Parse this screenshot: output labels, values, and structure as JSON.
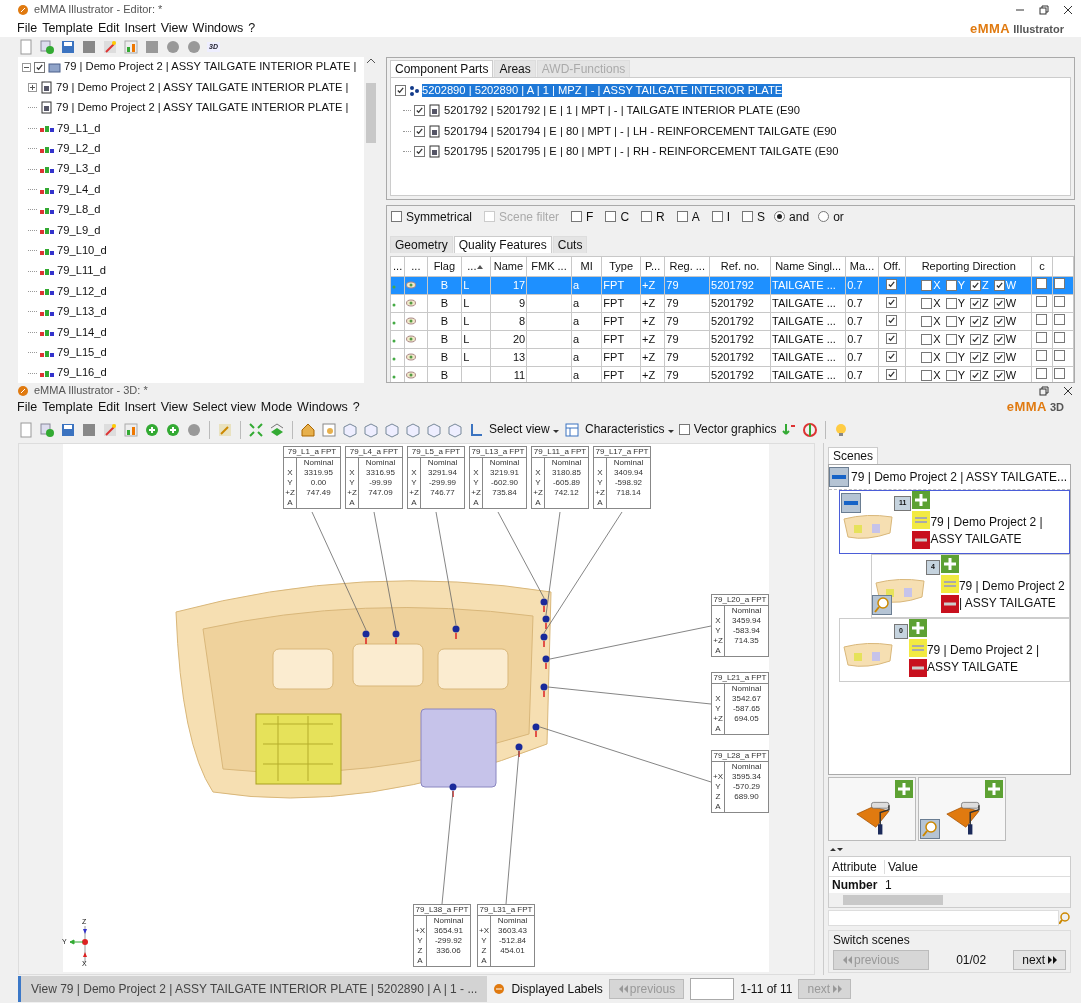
{
  "editor": {
    "title": "eMMA Illustrator - Editor: *",
    "brand_mark": "eMMA",
    "brand_name": "Illustrator",
    "menus": [
      "File",
      "Template",
      "Edit",
      "Insert",
      "View",
      "Windows",
      "?"
    ],
    "toolbar_badge": "3D",
    "tree": {
      "kind": "project",
      "label": "79 | Demo Project 2 | ASSY TAILGATE INTERIOR PLATE |",
      "checked": true,
      "expanded": true,
      "children": [
        {
          "kind": "part",
          "label": "79 | Demo Project 2 | ASSY TAILGATE INTERIOR PLATE |",
          "expanded": false
        },
        {
          "kind": "part",
          "label": "79 | Demo Project 2 | ASSY TAILGATE INTERIOR PLATE |"
        },
        {
          "kind": "feature",
          "label": "79_L1_d"
        },
        {
          "kind": "feature",
          "label": "79_L2_d"
        },
        {
          "kind": "feature",
          "label": "79_L3_d"
        },
        {
          "kind": "feature",
          "label": "79_L4_d"
        },
        {
          "kind": "feature",
          "label": "79_L8_d"
        },
        {
          "kind": "feature",
          "label": "79_L9_d"
        },
        {
          "kind": "feature",
          "label": "79_L10_d"
        },
        {
          "kind": "feature",
          "label": "79_L11_d"
        },
        {
          "kind": "feature",
          "label": "79_L12_d"
        },
        {
          "kind": "feature",
          "label": "79_L13_d"
        },
        {
          "kind": "feature",
          "label": "79_L14_d"
        },
        {
          "kind": "feature",
          "label": "79_L15_d"
        },
        {
          "kind": "feature",
          "label": "79_L16_d"
        }
      ]
    },
    "parts": {
      "tabs": [
        {
          "label": "Component Parts",
          "selected": true,
          "disabled": false
        },
        {
          "label": "Areas",
          "selected": false,
          "disabled": false
        },
        {
          "label": "AWD-Functions",
          "selected": false,
          "disabled": true
        }
      ],
      "items": [
        {
          "kind": "assembly",
          "label": "5202890 | 5202890 | A | 1 | MPZ | - | ASSY TAILGATE INTERIOR PLATE",
          "checked": true,
          "selected": true,
          "children": [
            {
              "kind": "part",
              "label": "5201792 | 5201792 | E | 1 | MPT | - | TAILGATE INTERIOR PLATE (E90",
              "checked": true,
              "selected": false
            },
            {
              "kind": "part",
              "label": "5201794 | 5201794 | E | 80 | MPT | - | LH - REINFORCEMENT TAILGATE (E90",
              "checked": true,
              "selected": false
            },
            {
              "kind": "part",
              "label": "5201795 | 5201795 | E | 80 | MPT | - | RH - REINFORCEMENT TAILGATE (E90",
              "checked": true,
              "selected": false
            }
          ]
        }
      ]
    },
    "filters": {
      "symmetrical": {
        "label": "Symmetrical",
        "checked": false
      },
      "scene_filter": {
        "label": "Scene filter",
        "checked": false,
        "disabled": true
      },
      "flags": [
        {
          "label": "F",
          "checked": false
        },
        {
          "label": "C",
          "checked": false
        },
        {
          "label": "R",
          "checked": false
        },
        {
          "label": "A",
          "checked": false
        },
        {
          "label": "I",
          "checked": false
        },
        {
          "label": "S",
          "checked": false
        }
      ],
      "modes": [
        {
          "label": "and",
          "selected": true
        },
        {
          "label": "or",
          "selected": false
        }
      ]
    },
    "feature_tabs": [
      {
        "label": "Geometry",
        "selected": false
      },
      {
        "label": "Quality Features",
        "selected": true
      },
      {
        "label": "Cuts",
        "selected": false
      }
    ],
    "table": {
      "columns": [
        {
          "label": "...",
          "sorted": false
        },
        {
          "label": "...",
          "sorted": false
        },
        {
          "label": "Flag",
          "sorted": false
        },
        {
          "label": "...",
          "sorted": true
        },
        {
          "label": "Name",
          "sorted": false
        },
        {
          "label": "FMK ...",
          "sorted": false
        },
        {
          "label": "MI",
          "sorted": false
        },
        {
          "label": "Type",
          "sorted": false
        },
        {
          "label": "P...",
          "sorted": false
        },
        {
          "label": "Reg. ...",
          "sorted": false
        },
        {
          "label": "Ref. no.",
          "sorted": false
        },
        {
          "label": "Name Singl...",
          "sorted": false
        },
        {
          "label": "Ma...",
          "sorted": false
        },
        {
          "label": "Off.",
          "sorted": false
        },
        {
          "label": "Reporting Direction",
          "sorted": false
        },
        {
          "label": "c",
          "sorted": false
        }
      ],
      "rows": [
        {
          "selected": true,
          "flag": "B",
          "column_4": "L",
          "name": "17",
          "mi": "a",
          "type": "FPT",
          "p": "+Z",
          "reg": "79",
          "ref": "5201792",
          "name_single": "TAILGATE ...",
          "ma": "0.7",
          "off": true,
          "directions": [
            {
              "axis": "X",
              "checked": false
            },
            {
              "axis": "Y",
              "checked": false
            },
            {
              "axis": "Z",
              "checked": true
            },
            {
              "axis": "W",
              "checked": true
            }
          ],
          "c": false,
          "column_17": false
        },
        {
          "selected": false,
          "flag": "B",
          "column_4": "L",
          "name": "9",
          "mi": "a",
          "type": "FPT",
          "p": "+Z",
          "reg": "79",
          "ref": "5201792",
          "name_single": "TAILGATE ...",
          "ma": "0.7",
          "off": true,
          "directions": [
            {
              "axis": "X",
              "checked": false
            },
            {
              "axis": "Y",
              "checked": false
            },
            {
              "axis": "Z",
              "checked": true
            },
            {
              "axis": "W",
              "checked": true
            }
          ],
          "c": false,
          "column_17": false
        },
        {
          "selected": false,
          "flag": "B",
          "column_4": "L",
          "name": "8",
          "mi": "a",
          "type": "FPT",
          "p": "+Z",
          "reg": "79",
          "ref": "5201792",
          "name_single": "TAILGATE ...",
          "ma": "0.7",
          "off": true,
          "directions": [
            {
              "axis": "X",
              "checked": false
            },
            {
              "axis": "Y",
              "checked": false
            },
            {
              "axis": "Z",
              "checked": true
            },
            {
              "axis": "W",
              "checked": true
            }
          ],
          "c": false,
          "column_17": false
        },
        {
          "selected": false,
          "flag": "B",
          "column_4": "L",
          "name": "20",
          "mi": "a",
          "type": "FPT",
          "p": "+Z",
          "reg": "79",
          "ref": "5201792",
          "name_single": "TAILGATE ...",
          "ma": "0.7",
          "off": true,
          "directions": [
            {
              "axis": "X",
              "checked": false
            },
            {
              "axis": "Y",
              "checked": false
            },
            {
              "axis": "Z",
              "checked": true
            },
            {
              "axis": "W",
              "checked": true
            }
          ],
          "c": false,
          "column_17": false
        },
        {
          "selected": false,
          "flag": "B",
          "column_4": "L",
          "name": "13",
          "mi": "a",
          "type": "FPT",
          "p": "+Z",
          "reg": "79",
          "ref": "5201792",
          "name_single": "TAILGATE ...",
          "ma": "0.7",
          "off": true,
          "directions": [
            {
              "axis": "X",
              "checked": false
            },
            {
              "axis": "Y",
              "checked": false
            },
            {
              "axis": "Z",
              "checked": true
            },
            {
              "axis": "W",
              "checked": true
            }
          ],
          "c": false,
          "column_17": false
        },
        {
          "selected": false,
          "flag": "B",
          "name": "11",
          "mi": "a",
          "type": "FPT",
          "p": "+Z",
          "reg": "79",
          "ref": "5201792",
          "name_single": "TAILGATE ...",
          "ma": "0.7",
          "off": true,
          "directions": [
            {
              "axis": "X",
              "checked": false
            },
            {
              "axis": "Y",
              "checked": false
            },
            {
              "axis": "Z",
              "checked": true
            },
            {
              "axis": "W",
              "checked": true
            }
          ],
          "c": false,
          "column_17": false
        }
      ]
    }
  },
  "viewer": {
    "title": "eMMA Illustrator - 3D: *",
    "brand_mark": "eMMA",
    "brand_name": "3D",
    "menus": [
      "File",
      "Template",
      "Edit",
      "Insert",
      "View",
      "Select view",
      "Mode",
      "Windows",
      "?"
    ],
    "toolbar": {
      "select_view": "Select view",
      "characteristics": "Characteristics",
      "vector_graphics": {
        "label": "Vector graphics",
        "checked": false
      }
    },
    "labels": [
      {
        "title": "79_L1_a FPT",
        "header": "Nominal",
        "rows": [
          {
            "axis": "X",
            "value": "3319.95"
          },
          {
            "axis": "Y",
            "value": "0.00"
          },
          {
            "axis": "+Z",
            "value": "747.49"
          },
          {
            "axis": "A"
          }
        ]
      },
      {
        "title": "79_L4_a FPT",
        "header": "Nominal",
        "rows": [
          {
            "axis": "X",
            "value": "3316.95"
          },
          {
            "axis": "Y",
            "value": "-99.99"
          },
          {
            "axis": "+Z",
            "value": "747.09"
          },
          {
            "axis": "A"
          }
        ]
      },
      {
        "title": "79_L5_a FPT",
        "header": "Nominal",
        "rows": [
          {
            "axis": "X",
            "value": "3291.94"
          },
          {
            "axis": "Y",
            "value": "-299.99"
          },
          {
            "axis": "+Z",
            "value": "746.77"
          },
          {
            "axis": "A"
          }
        ]
      },
      {
        "title": "79_L13_a FPT",
        "header": "Nominal",
        "rows": [
          {
            "axis": "X",
            "value": "3219.91"
          },
          {
            "axis": "Y",
            "value": "-602.90"
          },
          {
            "axis": "+Z",
            "value": "735.84"
          },
          {
            "axis": "A"
          }
        ]
      },
      {
        "title": "79_L11_a FPT",
        "header": "Nominal",
        "rows": [
          {
            "axis": "X",
            "value": "3180.85"
          },
          {
            "axis": "Y",
            "value": "-605.89"
          },
          {
            "axis": "+Z",
            "value": "742.12"
          },
          {
            "axis": "A"
          }
        ]
      },
      {
        "title": "79_L17_a FPT",
        "header": "Nominal",
        "rows": [
          {
            "axis": "X",
            "value": "3409.94"
          },
          {
            "axis": "Y",
            "value": "-598.92"
          },
          {
            "axis": "+Z",
            "value": "718.14"
          },
          {
            "axis": "A"
          }
        ]
      },
      {
        "title": "79_L20_a FPT",
        "header": "Nominal",
        "rows": [
          {
            "axis": "X",
            "value": "3459.94"
          },
          {
            "axis": "Y",
            "value": "-583.94"
          },
          {
            "axis": "+Z",
            "value": "714.35"
          },
          {
            "axis": "A"
          }
        ]
      },
      {
        "title": "79_L21_a FPT",
        "header": "Nominal",
        "rows": [
          {
            "axis": "X",
            "value": "3542.67"
          },
          {
            "axis": "Y",
            "value": "-587.65"
          },
          {
            "axis": "+Z",
            "value": "694.05"
          },
          {
            "axis": "A"
          }
        ]
      },
      {
        "title": "79_L28_a FPT",
        "header": "Nominal",
        "rows": [
          {
            "axis": "+X",
            "value": "3595.34"
          },
          {
            "axis": "Y",
            "value": "-570.29"
          },
          {
            "axis": "Z",
            "value": "689.90"
          },
          {
            "axis": "A"
          }
        ]
      },
      {
        "title": "79_L38_a FPT",
        "header": "Nominal",
        "rows": [
          {
            "axis": "+X",
            "value": "3654.91"
          },
          {
            "axis": "Y",
            "value": "-299.92"
          },
          {
            "axis": "Z",
            "value": "336.06"
          },
          {
            "axis": "A"
          }
        ]
      },
      {
        "title": "79_L31_a FPT",
        "header": "Nominal",
        "rows": [
          {
            "axis": "+X",
            "value": "3603.43"
          },
          {
            "axis": "Y",
            "value": "-512.84"
          },
          {
            "axis": "Z",
            "value": "454.01"
          },
          {
            "axis": "A"
          }
        ]
      }
    ],
    "axes": {
      "y": "Y",
      "z": "Z",
      "x": "X"
    },
    "scenes": {
      "tab": "Scenes",
      "root": {
        "label": "79 | Demo Project 2 | ASSY TAILGATE...",
        "expanded": true,
        "children": [
          {
            "count": "11",
            "label": "79 | Demo Project 2 | ASSY TAILGATE",
            "selected": true,
            "zoomed": false,
            "expanded": true,
            "children": [
              {
                "count": "4",
                "label": "79 | Demo Project 2 | ASSY TAILGATE",
                "selected": false,
                "zoomed": true
              }
            ]
          },
          {
            "count": "0",
            "label": "79 | Demo Project 2 | ASSY TAILGATE",
            "selected": false,
            "zoomed": false
          }
        ]
      },
      "templates": [
        {
          "zoomed": false
        },
        {
          "zoomed": true
        }
      ],
      "attributes": {
        "columns": [
          "Attribute",
          "Value"
        ],
        "rows": [
          {
            "attribute": "Number",
            "value": "1"
          }
        ]
      },
      "switch": {
        "title": "Switch scenes",
        "previous": {
          "label": "previous",
          "disabled": true
        },
        "page": "01/02",
        "next": {
          "label": "next",
          "disabled": false
        }
      }
    },
    "status": {
      "view": "View 79 | Demo Project 2 | ASSY TAILGATE INTERIOR PLATE | 5202890 | A | 1 - ...",
      "labels_title": "Displayed Labels",
      "previous": {
        "label": "previous",
        "disabled": true
      },
      "range": "1-11 of 11",
      "next": {
        "label": "next",
        "disabled": true
      }
    }
  }
}
